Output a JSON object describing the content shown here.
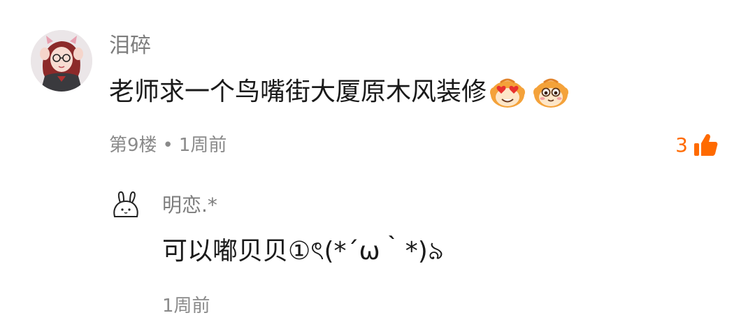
{
  "comment": {
    "username": "泪碎",
    "text": "老师求一个鸟嘴街大厦原木风装修",
    "emojis": [
      "heart-eyes-monkey-emoji",
      "monkey-face-emoji"
    ],
    "floor": "第9楼",
    "separator": "•",
    "time": "1周前",
    "like_count": "3",
    "like_color": "#ff6a00"
  },
  "reply": {
    "username": "明恋.*",
    "text": "可以嘟贝贝①ৎ(*´ω｀*)৯",
    "time": "1周前"
  },
  "icons": {
    "like": "thumbs-up-icon",
    "reply_avatar": "bunny-avatar-icon"
  }
}
